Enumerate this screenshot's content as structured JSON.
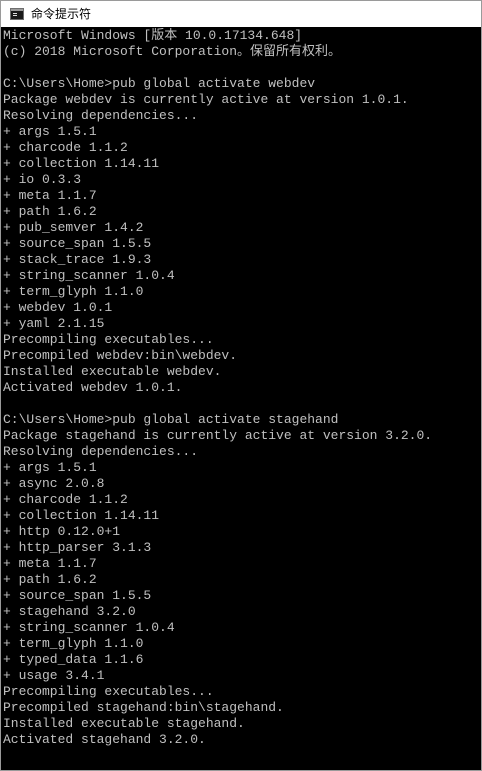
{
  "window": {
    "title": "命令提示符",
    "icon": "command-prompt-icon"
  },
  "console": {
    "lines": [
      "Microsoft Windows [版本 10.0.17134.648]",
      "(c) 2018 Microsoft Corporation。保留所有权利。",
      "",
      "C:\\Users\\Home>pub global activate webdev",
      "Package webdev is currently active at version 1.0.1.",
      "Resolving dependencies...",
      "+ args 1.5.1",
      "+ charcode 1.1.2",
      "+ collection 1.14.11",
      "+ io 0.3.3",
      "+ meta 1.1.7",
      "+ path 1.6.2",
      "+ pub_semver 1.4.2",
      "+ source_span 1.5.5",
      "+ stack_trace 1.9.3",
      "+ string_scanner 1.0.4",
      "+ term_glyph 1.1.0",
      "+ webdev 1.0.1",
      "+ yaml 2.1.15",
      "Precompiling executables...",
      "Precompiled webdev:bin\\webdev.",
      "Installed executable webdev.",
      "Activated webdev 1.0.1.",
      "",
      "C:\\Users\\Home>pub global activate stagehand",
      "Package stagehand is currently active at version 3.2.0.",
      "Resolving dependencies...",
      "+ args 1.5.1",
      "+ async 2.0.8",
      "+ charcode 1.1.2",
      "+ collection 1.14.11",
      "+ http 0.12.0+1",
      "+ http_parser 3.1.3",
      "+ meta 1.1.7",
      "+ path 1.6.2",
      "+ source_span 1.5.5",
      "+ stagehand 3.2.0",
      "+ string_scanner 1.0.4",
      "+ term_glyph 1.1.0",
      "+ typed_data 1.1.6",
      "+ usage 3.4.1",
      "Precompiling executables...",
      "Precompiled stagehand:bin\\stagehand.",
      "Installed executable stagehand.",
      "Activated stagehand 3.2.0."
    ]
  }
}
